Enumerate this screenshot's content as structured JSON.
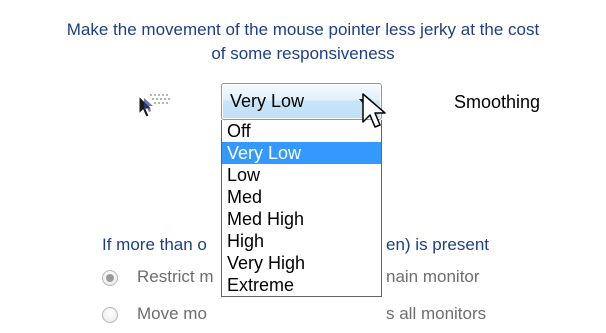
{
  "description": {
    "line1": "Make the movement of the mouse pointer less jerky at the cost",
    "line2": "of some responsiveness"
  },
  "smoothing": {
    "selected_value": "Very Low",
    "label": "Smoothing",
    "options": [
      "Off",
      "Very Low",
      "Low",
      "Med",
      "Med High",
      "High",
      "Very High",
      "Extreme"
    ],
    "selected_index": 1
  },
  "monitors": {
    "heading_left": "If more than o",
    "heading_right": "en) is present",
    "options": [
      {
        "label_left": "Restrict m",
        "label_right": "nain monitor",
        "checked": true
      },
      {
        "label_left": "Move mo",
        "label_right": "s all monitors",
        "checked": false
      }
    ]
  },
  "icons": {
    "pointer_trail": "mouse-pointer-trail-icon",
    "cursor": "mouse-cursor-icon"
  },
  "colors": {
    "heading_text": "#1d3f86",
    "selection_highlight": "#3399ff",
    "disabled_text": "#6d6d6d"
  }
}
